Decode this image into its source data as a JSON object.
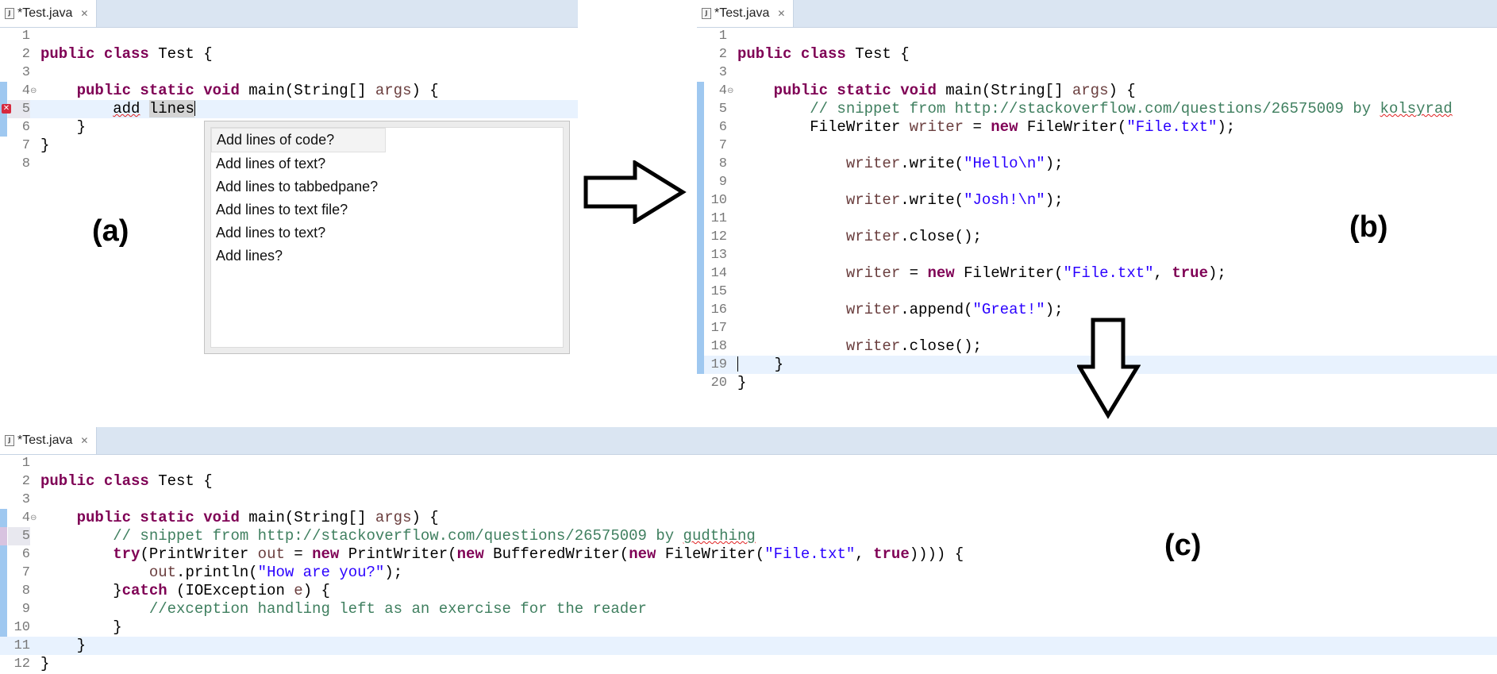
{
  "panel_a": {
    "tab_title": "*Test.java",
    "label": "(a)",
    "lines": [
      "1",
      "2",
      "3",
      "4",
      "5",
      "6",
      "7",
      "8"
    ],
    "code": {
      "l2_kw": "public class",
      "l2_rest": " Test {",
      "l4_kw1": "public static void",
      "l4_m": " main(String[] ",
      "l4_arg": "args",
      "l4_end": ") {",
      "l5_a": "add",
      "l5_b": "lines",
      "l6": "}",
      "l7": "}"
    },
    "suggestions": [
      "Add lines of code?",
      "Add lines of text?",
      "Add lines to tabbedpane?",
      "Add lines to text file?",
      "Add lines to text?",
      "Add lines?"
    ]
  },
  "panel_b": {
    "tab_title": "*Test.java",
    "label": "(b)",
    "lines": [
      "1",
      "2",
      "3",
      "4",
      "5",
      "6",
      "7",
      "8",
      "9",
      "10",
      "11",
      "12",
      "13",
      "14",
      "15",
      "16",
      "17",
      "18",
      "19",
      "20"
    ],
    "code": {
      "l2_kw": "public class",
      "l2_rest": " Test {",
      "l4_kw1": "public static void",
      "l4_m": " main(String[] ",
      "l4_arg": "args",
      "l4_end": ") {",
      "l5_cm": "// snippet from http://stackoverflow.com/questions/26575009 by ",
      "l5_user": "kolsyrad",
      "l6_a": "FileWriter ",
      "l6_var": "writer",
      "l6_b": " = ",
      "l6_kw": "new",
      "l6_c": " FileWriter(",
      "l6_str": "\"File.txt\"",
      "l6_d": ");",
      "l8_var": "writer",
      "l8_a": ".write(",
      "l8_str": "\"Hello\\n\"",
      "l8_b": ");",
      "l10_var": "writer",
      "l10_a": ".write(",
      "l10_str": "\"Josh!\\n\"",
      "l10_b": ");",
      "l12_var": "writer",
      "l12_a": ".close();",
      "l14_var": "writer",
      "l14_a": " = ",
      "l14_kw": "new",
      "l14_b": " FileWriter(",
      "l14_str": "\"File.txt\"",
      "l14_c": ", ",
      "l14_kw2": "true",
      "l14_d": ");",
      "l16_var": "writer",
      "l16_a": ".append(",
      "l16_str": "\"Great!\"",
      "l16_b": ");",
      "l18_var": "writer",
      "l18_a": ".close();",
      "l19": "}",
      "l20": "}"
    }
  },
  "panel_c": {
    "tab_title": "*Test.java",
    "label": "(c)",
    "lines": [
      "1",
      "2",
      "3",
      "4",
      "5",
      "6",
      "7",
      "8",
      "9",
      "10",
      "11",
      "12"
    ],
    "code": {
      "l2_kw": "public class",
      "l2_rest": " Test {",
      "l4_kw1": "public static void",
      "l4_m": " main(String[] ",
      "l4_arg": "args",
      "l4_end": ") {",
      "l5_cm": "// snippet from http://stackoverflow.com/questions/26575009 by ",
      "l5_user": "gudthing",
      "l6_kw": "try",
      "l6_a": "(PrintWriter ",
      "l6_var": "out",
      "l6_b": " = ",
      "l6_kw2": "new",
      "l6_c": " PrintWriter(",
      "l6_kw3": "new",
      "l6_d": " BufferedWriter(",
      "l6_kw4": "new",
      "l6_e": " FileWriter(",
      "l6_str": "\"File.txt\"",
      "l6_f": ", ",
      "l6_kw5": "true",
      "l6_g": ")))) {",
      "l7_var": "out",
      "l7_a": ".println(",
      "l7_str": "\"How are you?\"",
      "l7_b": ");",
      "l8_a": "}",
      "l8_kw": "catch",
      "l8_b": " (IOException ",
      "l8_var": "e",
      "l8_c": ") {",
      "l9_cm": "//exception handling left as an exercise for the reader",
      "l10": "}",
      "l11": "}",
      "l12": "}"
    }
  },
  "colors": {
    "keyword": "#7f0055",
    "string": "#2a00ff",
    "comment": "#3f7f5f",
    "variable": "#6a3e3e",
    "tabbar": "#dae5f2"
  },
  "icons": {
    "tab_icon": "java-file-icon",
    "tab_close": "close-icon",
    "error": "error-icon",
    "fold": "fold-icon",
    "arrows": [
      "arrow-right-icon",
      "arrow-down-icon"
    ]
  }
}
